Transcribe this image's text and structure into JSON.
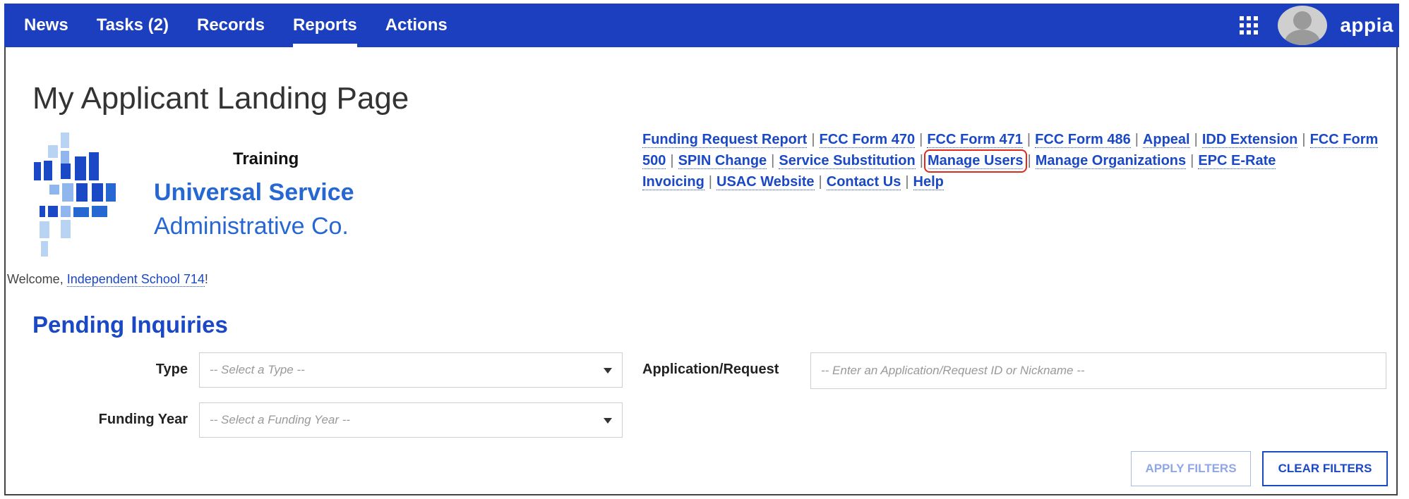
{
  "nav": {
    "items": [
      {
        "label": "News"
      },
      {
        "label": "Tasks (2)"
      },
      {
        "label": "Records"
      },
      {
        "label": "Reports",
        "active": true
      },
      {
        "label": "Actions"
      }
    ],
    "brand": "appia"
  },
  "page": {
    "title": "My Applicant Landing Page"
  },
  "logo": {
    "training": "Training",
    "line1": "Universal Service",
    "line2": "Administrative Co."
  },
  "links": [
    "Funding Request Report",
    "FCC Form 470",
    "FCC Form 471",
    "FCC Form 486",
    "Appeal",
    "IDD Extension",
    "FCC Form 500",
    "SPIN Change",
    "Service Substitution",
    "Manage Users",
    "Manage Organizations",
    "EPC E-Rate Invoicing",
    "USAC Website",
    "Contact Us",
    "Help"
  ],
  "welcome": {
    "prefix": "Welcome, ",
    "name": "Independent School 714",
    "suffix": "!"
  },
  "pending": {
    "title": "Pending Inquiries",
    "type_label": "Type",
    "type_placeholder": "-- Select a Type --",
    "year_label": "Funding Year",
    "year_placeholder": "-- Select a Funding Year --",
    "app_label": "Application/Request",
    "app_placeholder": "-- Enter an Application/Request ID or Nickname --",
    "apply_label": "APPLY FILTERS",
    "clear_label": "CLEAR FILTERS"
  },
  "colors": {
    "nav_bg": "#1c3fbf",
    "link": "#1b48c4",
    "highlight": "#e0281c",
    "logo": "#2767d2"
  }
}
